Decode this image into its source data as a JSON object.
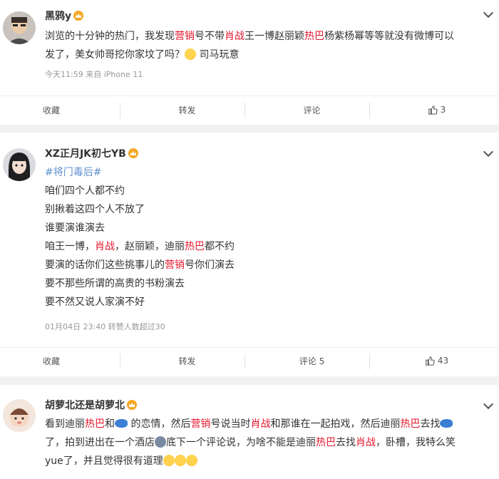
{
  "posts": [
    {
      "username": "黑鸦y",
      "content_lines": [
        [
          "浏览的十分钟的热门，我发现",
          "营销",
          "号不带",
          "肖战",
          "王一博赵丽颖",
          "热巴",
          "杨紫杨幂等等就没有微博可以"
        ],
        [
          "发了，美女帅哥挖你家坟了吗？",
          "",
          "司马玩意"
        ]
      ],
      "meta": "今天11:59  来自 iPhone 11",
      "actions": {
        "collect": "收藏",
        "repost": "转发",
        "comment": "评论",
        "like_count": "3"
      },
      "icons": [
        "avatar",
        "vip-badge-icon",
        "chevron-down-icon",
        "cry-emoji-icon",
        "thumb-up-icon"
      ]
    },
    {
      "username": "XZ正月JK初七YB",
      "topic": "#将门毒后#",
      "lines": [
        "咱们四个人都不约",
        "别揪着这四个人不放了",
        "谁要演谁演去"
      ],
      "line4_parts": [
        "咱王一博，",
        "肖战",
        "，赵丽颖，迪丽",
        "热巴",
        "都不约"
      ],
      "line5_parts": [
        "要演的话你们这些挑事儿的",
        "营销",
        "号你们演去"
      ],
      "line6": "要不那些所谓的高贵的书粉演去",
      "line7": "要不然又说人家演不好",
      "meta": "01月04日 23:40 转赞人数超过30",
      "actions": {
        "collect": "收藏",
        "repost": "转发",
        "comment": "评论 5",
        "like_count": "43"
      }
    },
    {
      "username": "胡萝北还是胡萝北",
      "line1_parts": [
        "看到迪丽",
        "热巴",
        "和",
        "",
        " 的恋情，然后",
        "营销",
        "号说当时",
        "肖战",
        "和那谁在一起拍戏，然后迪丽",
        "热巴",
        "去找"
      ],
      "line2_parts": [
        "了，拍到进出在一个酒店",
        "",
        "底下一个评论说，为啥不能是迪丽",
        "热巴",
        "去找",
        "肖战",
        "，卧槽，我特么笑"
      ],
      "line3_parts": [
        "yue了，并且觉得很有道理"
      ]
    }
  ],
  "colors": {
    "highlight": "#e6162d",
    "topic": "#5d8fcf",
    "meta": "#999999",
    "badge": "#f5a623"
  }
}
